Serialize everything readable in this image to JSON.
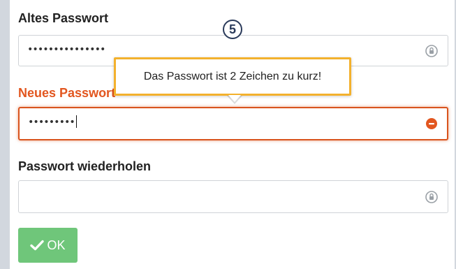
{
  "form": {
    "old_password": {
      "label": "Altes Passwort",
      "value": "•••••••••••••••"
    },
    "new_password": {
      "label": "Neues Passwort",
      "value": "•••••••••"
    },
    "repeat_password": {
      "label": "Passwort wiederholen",
      "value": ""
    },
    "submit_label": "OK"
  },
  "tooltip": {
    "text": "Das Passwort ist 2 Zeichen zu kurz!"
  },
  "step_badge": "5",
  "colors": {
    "error": "#e2561f",
    "tooltip_border": "#f3b12d",
    "ok_button": "#6fc67a",
    "badge": "#2a3a5a"
  },
  "icons": {
    "field_icon": "lock-icon",
    "error_field_icon": "error-icon",
    "button_icon": "check-icon"
  }
}
